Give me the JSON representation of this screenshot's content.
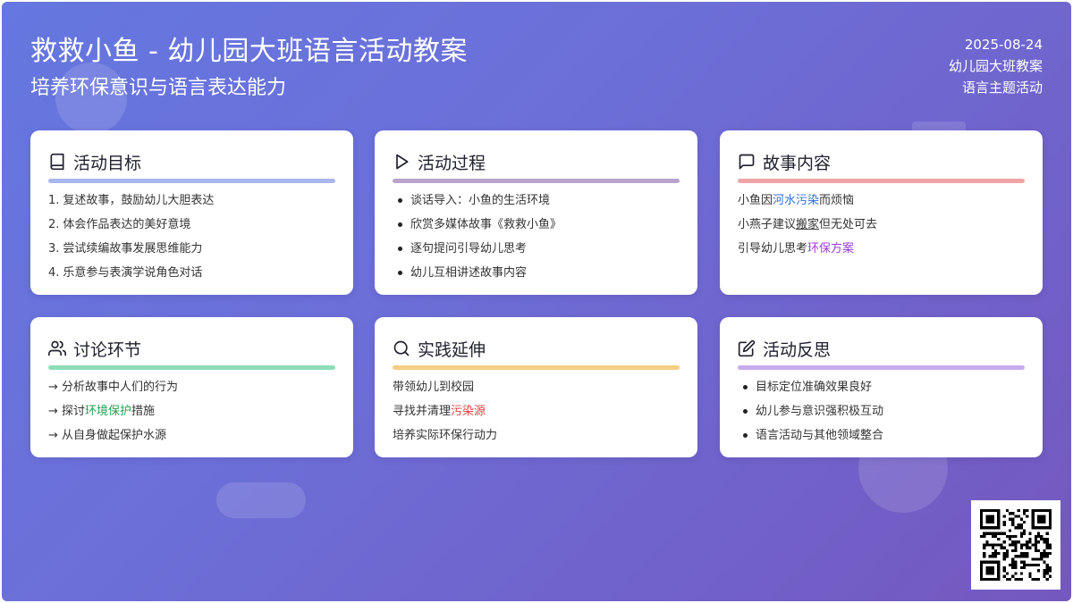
{
  "header": {
    "title": "救救小鱼 - 幼儿园大班语言活动教案",
    "subtitle": "培养环保意识与语言表达能力",
    "date": "2025-08-24",
    "meta1": "幼儿园大班教案",
    "meta2": "语言主题活动"
  },
  "cards": {
    "goals": {
      "title": "活动目标",
      "icon": "book-icon",
      "color": "#aab6ee",
      "items": [
        {
          "num": "1.",
          "text": "复述故事，鼓励幼儿大胆表达"
        },
        {
          "num": "2.",
          "text": "体会作品表达的美好意境"
        },
        {
          "num": "3.",
          "text": "尝试续编故事发展思维能力"
        },
        {
          "num": "4.",
          "text": "乐意参与表演学说角色对话"
        }
      ]
    },
    "process": {
      "title": "活动过程",
      "icon": "play-icon",
      "color": "#b9a3cc",
      "items": [
        "谈话导入：小鱼的生活环境",
        "欣赏多媒体故事《救救小鱼》",
        "逐句提问引导幼儿思考",
        "幼儿互相讲述故事内容"
      ]
    },
    "story": {
      "title": "故事内容",
      "icon": "message-icon",
      "color": "#f0a5a5",
      "line1": {
        "pre": "小鱼因",
        "hl": "河水污染",
        "post": "而烦恼"
      },
      "line2": {
        "pre": "小燕子建议",
        "hl": "搬家",
        "post": "但无处可去"
      },
      "line3": {
        "pre": "引导幼儿思考",
        "hl": "环保方案",
        "post": ""
      }
    },
    "discussion": {
      "title": "讨论环节",
      "icon": "users-icon",
      "color": "#8fdcb9",
      "line1": {
        "pre": "→ 分析故事中人们的行为"
      },
      "line2": {
        "pre": "→ 探讨",
        "hl": "环境保护",
        "post": "措施"
      },
      "line3": {
        "pre": "→ 从自身做起保护水源"
      }
    },
    "practice": {
      "title": "实践延伸",
      "icon": "search-icon",
      "color": "#f6cd85",
      "line1": {
        "pre": "带领幼儿到校园"
      },
      "line2": {
        "pre": "寻找并清理",
        "hl": "污染源",
        "post": ""
      },
      "line3": {
        "pre": "培养实际环保行动力"
      }
    },
    "reflection": {
      "title": "活动反思",
      "icon": "edit-icon",
      "color": "#c7abee",
      "items": [
        "目标定位准确效果良好",
        "幼儿参与意识强积极互动",
        "语言活动与其他领域整合"
      ]
    }
  }
}
